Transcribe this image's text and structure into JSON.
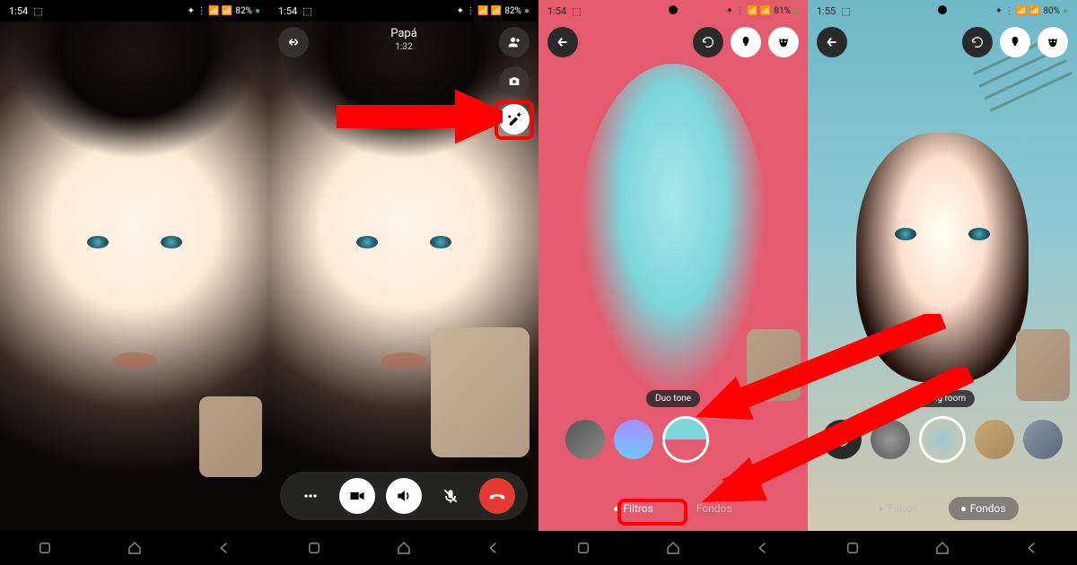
{
  "panels": [
    {
      "time": "1:54",
      "battery": "82%"
    },
    {
      "time": "1:54",
      "battery": "82%",
      "contact": "Papá",
      "duration": "1:32"
    },
    {
      "time": "1:54",
      "battery": "81%",
      "filter_name": "Duo tone",
      "tabs": [
        "Filtros",
        "Fondos"
      ],
      "active_tab": "Filtros"
    },
    {
      "time": "1:55",
      "battery": "80%",
      "bg_name": "Living room",
      "tabs": [
        "Filtros",
        "Fondos"
      ],
      "active_tab": "Fondos"
    }
  ],
  "colors": {
    "highlight": "#ff0000",
    "duotone_pink": "#e45a6e",
    "duotone_cyan": "#7cd5d8"
  },
  "filter_swatches": [
    {
      "bg": "linear-gradient(135deg,#555,#777)"
    },
    {
      "bg": "linear-gradient(180deg,#a88cff,#6ec8ff)"
    },
    {
      "bg": "linear-gradient(180deg,#7cd5d8 50%,#e45a6e 50%)",
      "selected": true
    }
  ],
  "bg_swatches": [
    {
      "bg": "#2a2a2a",
      "icon": "minus"
    },
    {
      "bg": "radial-gradient(circle,#888,#555)"
    },
    {
      "bg": "radial-gradient(circle,#6eb8c8,#d4c8b0)",
      "selected": true
    },
    {
      "bg": "linear-gradient(135deg,#c8a878,#a88858)"
    },
    {
      "bg": "linear-gradient(135deg,#8898a8,#586878)"
    }
  ]
}
